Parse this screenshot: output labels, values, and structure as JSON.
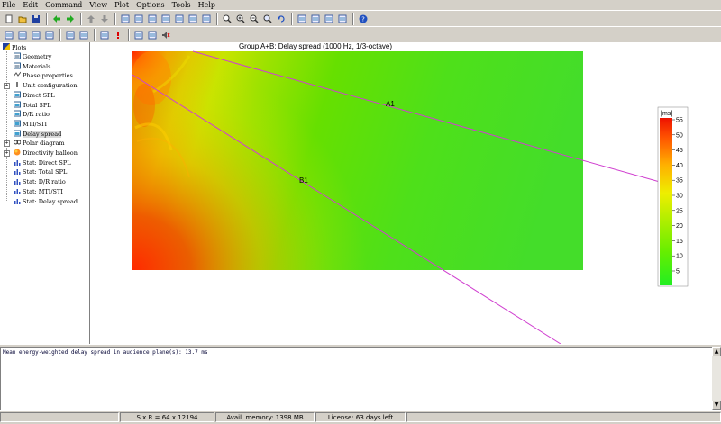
{
  "menu": [
    "File",
    "Edit",
    "Command",
    "View",
    "Plot",
    "Options",
    "Tools",
    "Help"
  ],
  "toolbar1": [
    "new-icon",
    "open-icon",
    "save-icon",
    "|",
    "back-arrow-icon",
    "forward-arrow-icon",
    "|",
    "up-arrow-icon",
    "down-arrow-icon",
    "|",
    "window-icon",
    "print-icon",
    "copy-icon",
    "window2-icon",
    "export-icon",
    "export2-icon",
    "cube-icon",
    "|",
    "zoom-icon",
    "zoom-in-icon",
    "zoom-out-icon",
    "zoom-fit-icon",
    "rotate-icon",
    "|",
    "table-icon",
    "check-icon",
    "layout-icon",
    "image-icon",
    "|",
    "help-icon"
  ],
  "toolbar2": [
    "folder-icon",
    "folder2-icon",
    "folder3-icon",
    "network-icon",
    "|",
    "plot-window-icon",
    "tools-icon",
    "|",
    "wand-icon",
    "alert-icon",
    "|",
    "graph-icon",
    "layers-icon",
    "speaker-icon"
  ],
  "tree": {
    "root": "Plots",
    "items": [
      {
        "label": "Geometry",
        "icon": "geometry-icon"
      },
      {
        "label": "Materials",
        "icon": "materials-icon"
      },
      {
        "label": "Phase properties",
        "icon": "phase-icon"
      },
      {
        "label": "Unit configuration",
        "icon": "unit-icon"
      },
      {
        "label": "Direct SPL",
        "icon": "plot-icon"
      },
      {
        "label": "Total SPL",
        "icon": "plot-icon"
      },
      {
        "label": "D/R ratio",
        "icon": "plot-icon"
      },
      {
        "label": "MTI/STI",
        "icon": "plot-icon"
      },
      {
        "label": "Delay spread",
        "icon": "plot-icon"
      },
      {
        "label": "Polar diagram",
        "icon": "polar-icon"
      },
      {
        "label": "Directivity balloon",
        "icon": "balloon-icon"
      },
      {
        "label": "Stat: Direct SPL",
        "icon": "bar-icon"
      },
      {
        "label": "Stat: Total SPL",
        "icon": "bar-icon"
      },
      {
        "label": "Stat: D/R ratio",
        "icon": "bar-icon"
      },
      {
        "label": "Stat: MTI/STI",
        "icon": "bar-icon"
      },
      {
        "label": "Stat: Delay spread",
        "icon": "bar-icon"
      }
    ]
  },
  "plot": {
    "title": "Group A+B: Delay spread (1000 Hz, 1/3-octave)",
    "line_a_label": "A1",
    "line_b_label": "B1",
    "line_color": "#d040d0",
    "colorbar_unit": "[ms]",
    "colorbar_ticks": [
      "5",
      "10",
      "15",
      "20",
      "25",
      "30",
      "35",
      "40",
      "45",
      "50",
      "55"
    ]
  },
  "output": {
    "text": "Mean energy-weighted delay spread in audience plane(s): 13.7 ms"
  },
  "status": {
    "grid": "S x R = 64 x 12194",
    "memory": "Avail. memory: 1398 MB",
    "license": "License: 63 days left"
  }
}
